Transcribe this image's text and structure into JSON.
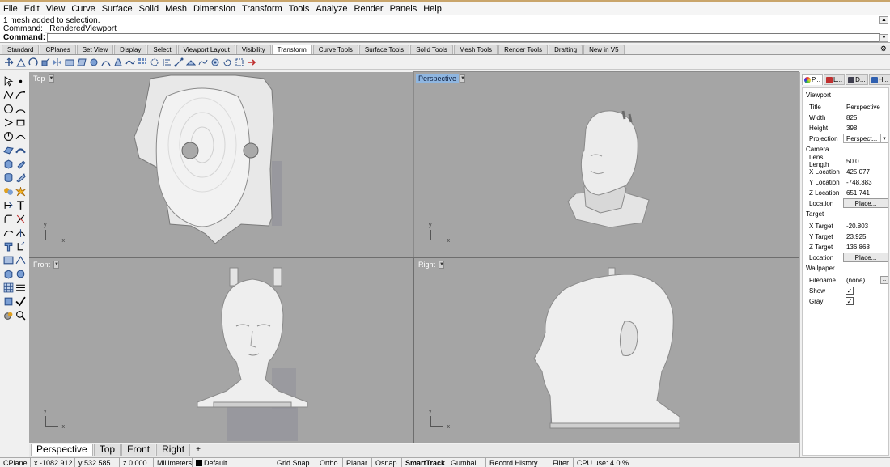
{
  "menu": [
    "File",
    "Edit",
    "View",
    "Curve",
    "Surface",
    "Solid",
    "Mesh",
    "Dimension",
    "Transform",
    "Tools",
    "Analyze",
    "Render",
    "Panels",
    "Help"
  ],
  "command": {
    "history": [
      "1 mesh added to selection.",
      "Command: _RenderedViewport"
    ],
    "prompt": "Command:",
    "value": ""
  },
  "toolbar_tabs": [
    "Standard",
    "CPlanes",
    "Set View",
    "Display",
    "Select",
    "Viewport Layout",
    "Visibility",
    "Transform",
    "Curve Tools",
    "Surface Tools",
    "Solid Tools",
    "Mesh Tools",
    "Render Tools",
    "Drafting",
    "New in V5"
  ],
  "active_toolbar_tab": "Transform",
  "viewports": {
    "top": {
      "label": "Top"
    },
    "perspective": {
      "label": "Perspective"
    },
    "front": {
      "label": "Front"
    },
    "right": {
      "label": "Right"
    },
    "axis_x": "x",
    "axis_y": "y"
  },
  "viewport_tabs": [
    "Perspective",
    "Top",
    "Front",
    "Right"
  ],
  "viewport_tab_add": "+",
  "panel": {
    "tabs": [
      "P...",
      "L...",
      "D...",
      "H..."
    ],
    "viewport_section": "Viewport",
    "title_label": "Title",
    "title_value": "Perspective",
    "width_label": "Width",
    "width_value": "825",
    "height_label": "Height",
    "height_value": "398",
    "projection_label": "Projection",
    "projection_value": "Perspect...",
    "camera_section": "Camera",
    "lens_label": "Lens Length",
    "lens_value": "50.0",
    "xloc_label": "X Location",
    "xloc_value": "425.077",
    "yloc_label": "Y Location",
    "yloc_value": "-748.383",
    "zloc_label": "Z Location",
    "zloc_value": "651.741",
    "location_label": "Location",
    "place_button": "Place...",
    "target_section": "Target",
    "xtgt_label": "X Target",
    "xtgt_value": "-20.803",
    "ytgt_label": "Y Target",
    "ytgt_value": "23.925",
    "ztgt_label": "Z Target",
    "ztgt_value": "136.868",
    "tlocation_label": "Location",
    "tplace_button": "Place...",
    "wallpaper_section": "Wallpaper",
    "filename_label": "Filename",
    "filename_value": "(none)",
    "browse_button": "...",
    "show_label": "Show",
    "show_checked": true,
    "gray_label": "Gray",
    "gray_checked": true
  },
  "status": {
    "cplane": "CPlane",
    "x": "x -1082.912",
    "y": "y 532.585",
    "z": "z 0.000",
    "units": "Millimeters",
    "layer": "Default",
    "grid_snap": "Grid Snap",
    "ortho": "Ortho",
    "planar": "Planar",
    "osnap": "Osnap",
    "smarttrack": "SmartTrack",
    "gumball": "Gumball",
    "record_history": "Record History",
    "filter": "Filter",
    "cpu": "CPU use: 4.0 %"
  },
  "colors": {
    "viewport_bg": "#a5a5a5",
    "active_label": "#8fb6e0",
    "model_fill": "#ececec"
  }
}
